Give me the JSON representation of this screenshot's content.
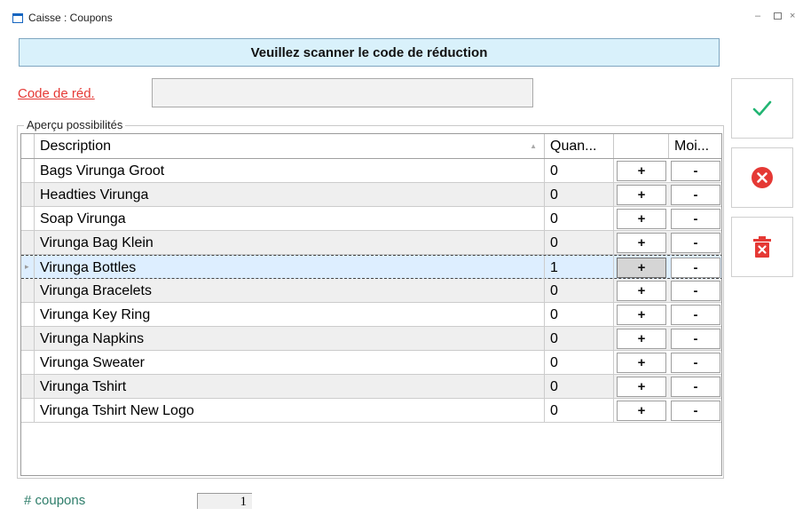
{
  "window": {
    "title": "Caisse : Coupons",
    "minimize": "–",
    "close": "×"
  },
  "banner": "Veuillez scanner le code de réduction",
  "code_field": {
    "label": "Code de réd.",
    "value": ""
  },
  "group_label": "Aperçu possibilités",
  "grid": {
    "headers": [
      "Description",
      "Quan...",
      "",
      "Moi..."
    ],
    "sort_glyph": "▲",
    "rows": [
      {
        "description": "Bags Virunga Groot",
        "quantity": "0",
        "plus": "+",
        "minus": "-"
      },
      {
        "description": "Headties Virunga",
        "quantity": "0",
        "plus": "+",
        "minus": "-"
      },
      {
        "description": "Soap Virunga",
        "quantity": "0",
        "plus": "+",
        "minus": "-"
      },
      {
        "description": "Virunga Bag Klein",
        "quantity": "0",
        "plus": "+",
        "minus": "-"
      },
      {
        "description": "Virunga Bottles",
        "quantity": "1",
        "plus": "+",
        "minus": "-"
      },
      {
        "description": "Virunga Bracelets",
        "quantity": "0",
        "plus": "+",
        "minus": "-"
      },
      {
        "description": "Virunga Key Ring",
        "quantity": "0",
        "plus": "+",
        "minus": "-"
      },
      {
        "description": "Virunga Napkins",
        "quantity": "0",
        "plus": "+",
        "minus": "-"
      },
      {
        "description": "Virunga Sweater",
        "quantity": "0",
        "plus": "+",
        "minus": "-"
      },
      {
        "description": "Virunga Tshirt",
        "quantity": "0",
        "plus": "+",
        "minus": "-"
      },
      {
        "description": "Virunga Tshirt New Logo",
        "quantity": "0",
        "plus": "+",
        "minus": "-"
      }
    ],
    "selected_row": 4,
    "current_row_marker": "▸"
  },
  "side_buttons": {
    "confirm_icon": "checkmark-icon",
    "cancel_icon": "cancel-circle-icon",
    "delete_icon": "trash-icon"
  },
  "colors": {
    "banner_bg": "#d9f1fb",
    "label_red": "#e53935",
    "confirm_green": "#22b573",
    "danger_red": "#e53935",
    "coupons_green": "#2e7d6a"
  },
  "coupons": {
    "label": "# coupons",
    "count": "1"
  }
}
